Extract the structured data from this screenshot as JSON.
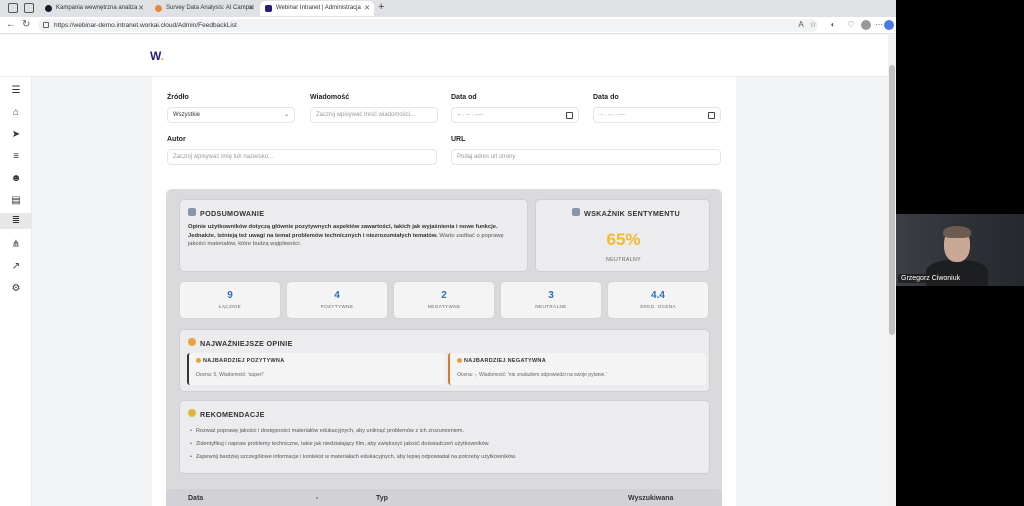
{
  "browser": {
    "tabs": [
      {
        "label": "Kampania wewnętrzna analiza",
        "active": false
      },
      {
        "label": "Survey Data Analysis: AI Campai",
        "active": false
      },
      {
        "label": "Webinar Intranet | Administracja",
        "active": true
      }
    ],
    "url": "https://webinar-demo.intranet.workai.cloud/Admin/FeedbackList"
  },
  "brand": {
    "logo_letter": "W",
    "logo_dot": "."
  },
  "filters": {
    "source_label": "Źródło",
    "source_value": "Wszystkie",
    "message_label": "Wiadomość",
    "message_placeholder": "Zacznij wpisywać treść wiadomości...",
    "date_from_label": "Data od",
    "date_from_value": "-- . -- . ----",
    "date_to_label": "Data do",
    "date_to_value": "-- . -- . ----",
    "author_label": "Autor",
    "author_placeholder": "Zacznij wpisywać imię lub nazwisko...",
    "url_label": "URL",
    "url_placeholder": "Podaj adres url strony"
  },
  "summary": {
    "title": "PODSUMOWANIE",
    "text_bold": "Opinie użytkowników dotyczą głównie pozytywnych aspektów zawartości, takich jak wyjaśnienia i nowe funkcje. Jednakże, istnieją też uwagi na temat problemów technicznych i niezrozumiałych tematów.",
    "text_rest": " Warto zadbać o poprawę jakości materiałów, które budzą wątpliwości."
  },
  "sentiment": {
    "title": "WSKAŹNIK SENTYMENTU",
    "value": "65%",
    "label": "NEUTRALNY",
    "color": "#f5b82e"
  },
  "stats": [
    {
      "value": "9",
      "label": "ŁĄCZNIE"
    },
    {
      "value": "4",
      "label": "POZYTYWNE"
    },
    {
      "value": "2",
      "label": "NEGATYWNE"
    },
    {
      "value": "3",
      "label": "NEUTRALNE"
    },
    {
      "value": "4.4",
      "label": "ŚRED. OCENA"
    }
  ],
  "top_opinions": {
    "title": "NAJWAŻNIEJSZE OPINIE",
    "positive_title": "NAJBARDZIEJ POZYTYWNA",
    "positive_text": "Ocena: 5, Wiadomość: 'super!'",
    "negative_title": "NAJBARDZIEJ NEGATYWNA",
    "negative_text": "Ocena: -, Wiadomość: 'nie znalazłem odpowiedzi na swoje pytanie.'"
  },
  "recommendations": {
    "title": "REKOMENDACJE",
    "items": [
      "Rozważ poprawę jakości i dostępności materiałów edukacyjnych, aby uniknąć problemów z ich zrozumieniem.",
      "Zidentyfikuj i napraw problemy techniczne, takie jak niedziałający film, aby zwiększyć jakość doświadczeń użytkowników.",
      "Zapewnij bardziej szczegółowe informacje i kontekst w materiałach edukacyjnych, aby lepiej odpowiadał na potrzeby użytkowników."
    ]
  },
  "table": {
    "col_date": "Data",
    "col_sort": "-",
    "col_type": "Typ",
    "col_search": "Wyszukiwana"
  },
  "webcam": {
    "name": "Grzegorz Ciwoniuk"
  }
}
